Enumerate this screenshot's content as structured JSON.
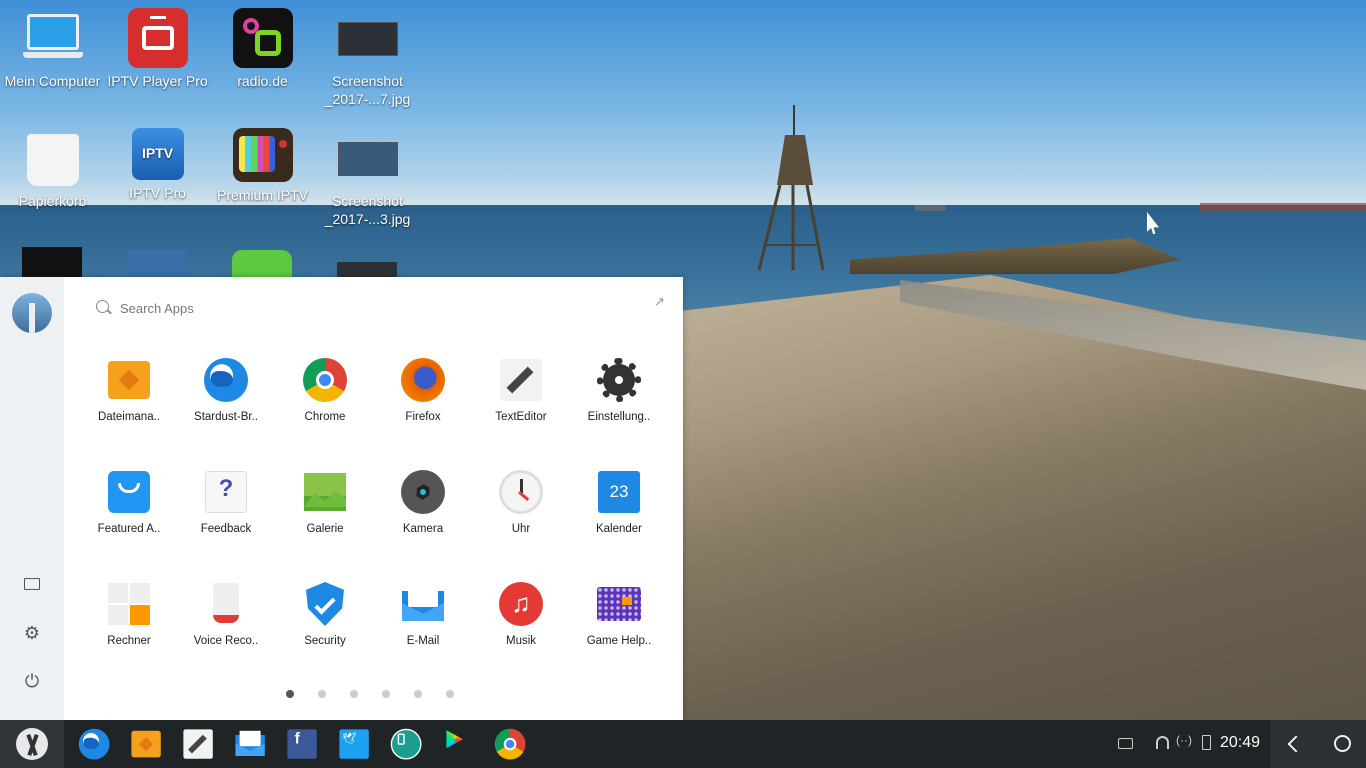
{
  "desktop": {
    "icons": [
      {
        "label": "Mein Computer",
        "icon": "laptop-icon"
      },
      {
        "label": "IPTV Player Pro",
        "icon": "tv-red-icon"
      },
      {
        "label": "radio.de",
        "icon": "radio-de-icon"
      },
      {
        "label": "Screenshot _2017-...7.jpg",
        "icon": "image-file-icon"
      },
      {
        "label": "Papierkorb",
        "icon": "trash-icon"
      },
      {
        "label": "IPTV Pro",
        "icon": "iptv-blue-icon"
      },
      {
        "label": "Premium IPTV",
        "icon": "retro-tv-icon"
      },
      {
        "label": "Screenshot _2017-...3.jpg",
        "icon": "image-file-icon"
      }
    ]
  },
  "launcher": {
    "search_placeholder": "Search Apps",
    "apps": [
      {
        "label": "Dateimana..",
        "icon": "file-manager-icon",
        "color": "#f6a11c"
      },
      {
        "label": "Stardust-Br..",
        "icon": "globe-icon",
        "color": "#1e88e5"
      },
      {
        "label": "Chrome",
        "icon": "chrome-icon",
        "color": "#4285f4"
      },
      {
        "label": "Firefox",
        "icon": "firefox-icon",
        "color": "#e66000"
      },
      {
        "label": "TextEditor",
        "icon": "pen-icon",
        "color": "#444444"
      },
      {
        "label": "Einstellung..",
        "icon": "settings-gear-icon",
        "color": "#333333"
      },
      {
        "label": "Featured A..",
        "icon": "shopping-bag-icon",
        "color": "#2196f3"
      },
      {
        "label": "Feedback",
        "icon": "question-icon",
        "color": "#3f51b5"
      },
      {
        "label": "Galerie",
        "icon": "gallery-icon",
        "color": "#8bc34a"
      },
      {
        "label": "Kamera",
        "icon": "camera-icon",
        "color": "#555555"
      },
      {
        "label": "Uhr",
        "icon": "clock-icon",
        "color": "#e53935"
      },
      {
        "label": "Kalender",
        "icon": "calendar-icon",
        "color": "#1e88e5"
      },
      {
        "label": "Rechner",
        "icon": "calculator-icon",
        "color": "#ff9800"
      },
      {
        "label": "Voice Reco..",
        "icon": "voice-recorder-icon",
        "color": "#e53935"
      },
      {
        "label": "Security",
        "icon": "shield-icon",
        "color": "#1e88e5"
      },
      {
        "label": "E-Mail",
        "icon": "mail-icon",
        "color": "#1e88e5"
      },
      {
        "label": "Musik",
        "icon": "music-icon",
        "color": "#e53935"
      },
      {
        "label": "Game Help..",
        "icon": "keyboard-icon",
        "color": "#5e35b1"
      }
    ],
    "pages": 6,
    "active_page": 1
  },
  "taskbar": {
    "apps": [
      {
        "name": "taskbar-browser",
        "icon": "globe-icon"
      },
      {
        "name": "taskbar-files",
        "icon": "file-manager-icon"
      },
      {
        "name": "taskbar-texteditor",
        "icon": "pen-icon"
      },
      {
        "name": "taskbar-mail",
        "icon": "mail-icon"
      },
      {
        "name": "taskbar-facebook",
        "icon": "facebook-icon"
      },
      {
        "name": "taskbar-twitter",
        "icon": "twitter-icon"
      },
      {
        "name": "taskbar-tablet",
        "icon": "tablet-icon"
      },
      {
        "name": "taskbar-play-store",
        "icon": "play-store-icon"
      },
      {
        "name": "taskbar-chrome",
        "icon": "chrome-icon"
      }
    ],
    "clock": "20:49"
  }
}
